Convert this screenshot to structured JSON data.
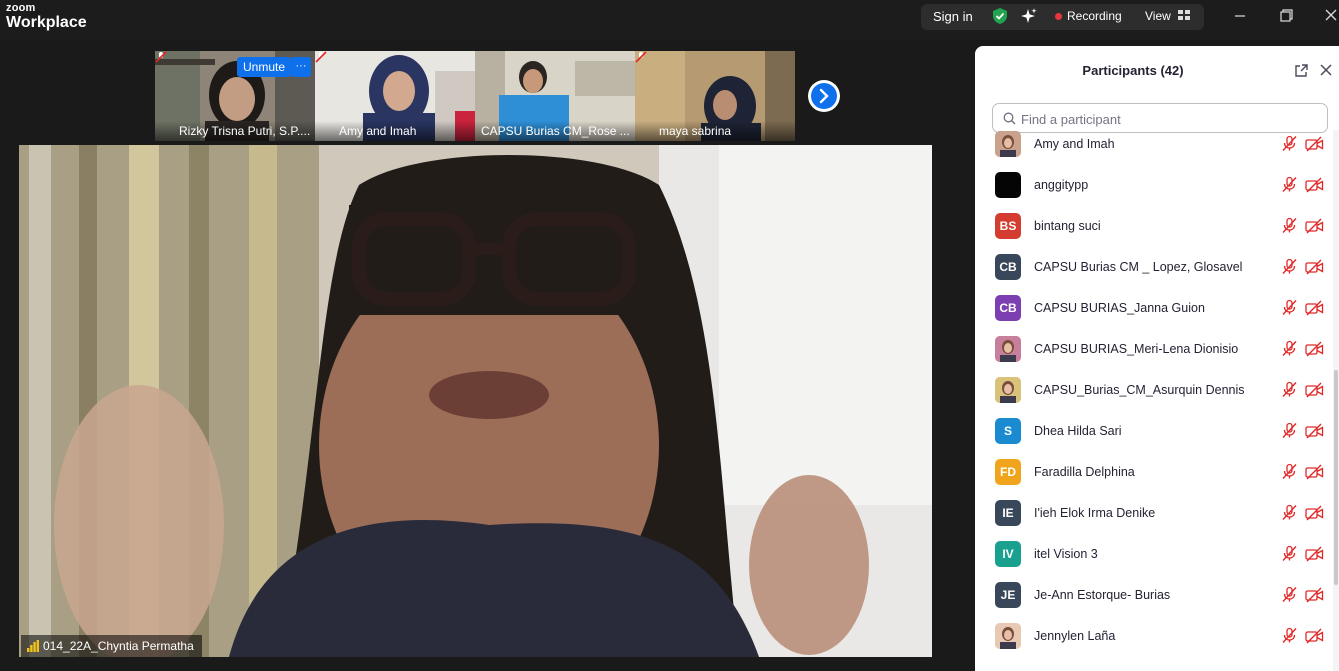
{
  "app": {
    "brand_top": "zoom",
    "brand_bottom": "Workplace"
  },
  "titlebar": {
    "sign_in": "Sign in",
    "recording_label": "Recording",
    "view_label": "View",
    "colors": {
      "recording_dot": "#e5363d",
      "shield": "#22a350"
    }
  },
  "strip": {
    "tiles": [
      {
        "name": "Rizky Trisna Putri, S.P....",
        "muted": true,
        "unmute_label": "Unmute",
        "more_label": "···"
      },
      {
        "name": "Amy and Imah",
        "muted": true
      },
      {
        "name": "CAPSU Burias CM_Rose ...",
        "muted": false
      },
      {
        "name": "maya sabrina",
        "muted": true
      }
    ],
    "next_icon": "chevron-right-icon"
  },
  "main_video": {
    "speaker_name": "014_22A_Chyntia Permatha"
  },
  "panel": {
    "title": "Participants (42)",
    "search_placeholder": "Find a participant",
    "participants": [
      {
        "name": "Amy and Imah",
        "initials": "",
        "color": "#c9a28d",
        "photo": true
      },
      {
        "name": "anggitypp",
        "initials": "",
        "color": "#050505",
        "photo": false
      },
      {
        "name": "bintang suci",
        "initials": "BS",
        "color": "#d33c2e",
        "photo": false
      },
      {
        "name": "CAPSU Burias CM _ Lopez, Glosavel",
        "initials": "CB",
        "color": "#39475a",
        "photo": false
      },
      {
        "name": "CAPSU BURIAS_Janna Guion",
        "initials": "CB",
        "color": "#7b3fb1",
        "photo": false
      },
      {
        "name": "CAPSU BURIAS_Meri-Lena Dionisio",
        "initials": "",
        "color": "#c77f9b",
        "photo": true
      },
      {
        "name": "CAPSU_Burias_CM_Asurquin Dennis",
        "initials": "",
        "color": "#d9c27a",
        "photo": true
      },
      {
        "name": "Dhea Hilda Sari",
        "initials": "S",
        "color": "#1a8bd1",
        "photo": false
      },
      {
        "name": "Faradilla Delphina",
        "initials": "FD",
        "color": "#f0a41b",
        "photo": false
      },
      {
        "name": "I'ieh Elok Irma Denike",
        "initials": "IE",
        "color": "#39475a",
        "photo": false
      },
      {
        "name": "itel Vision 3",
        "initials": "IV",
        "color": "#1aa08f",
        "photo": false
      },
      {
        "name": "Je-Ann Estorque- Burias",
        "initials": "JE",
        "color": "#39475a",
        "photo": false
      },
      {
        "name": "Jennylen Laña",
        "initials": "",
        "color": "#e8c9b4",
        "photo": true
      }
    ],
    "muted_color": "#e02828"
  }
}
